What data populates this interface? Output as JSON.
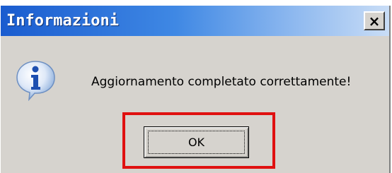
{
  "dialog": {
    "title": "Informazioni",
    "close_label": "×",
    "icon": "info-icon",
    "message": "Aggiornamento completato correttamente!",
    "ok_label": "OK",
    "highlight_color": "#e01010",
    "titlebar_color": "#1a5ccf"
  }
}
